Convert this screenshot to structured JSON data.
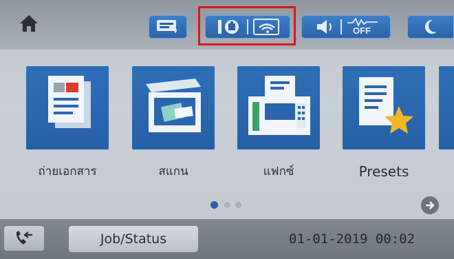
{
  "top_bar": {
    "icons": [
      "home-icon",
      "ink-levels-icon",
      "wired-lan-icon",
      "wifi-icon",
      "volume-icon",
      "quiet-mode-off-icon",
      "sleep-moon-icon"
    ],
    "quiet_mode_label": "OFF"
  },
  "menu_tiles": [
    {
      "label": "ถ่ายเอกสาร",
      "icon": "copy-document-icon"
    },
    {
      "label": "สแกน",
      "icon": "scanner-icon"
    },
    {
      "label": "แฟกซ์",
      "icon": "fax-machine-icon"
    },
    {
      "label": "Presets",
      "icon": "presets-star-icon"
    }
  ],
  "pagination": {
    "total_pages": 3,
    "current_page": 1
  },
  "bottom_bar": {
    "job_status_label": "Job/Status",
    "datetime": "01-01-2019 00:02"
  },
  "colors": {
    "tile_blue": "#2a66ad",
    "highlight_red": "#e0141b",
    "dot_active": "#2d5fa8",
    "dot_inactive": "#a9b0b7"
  }
}
